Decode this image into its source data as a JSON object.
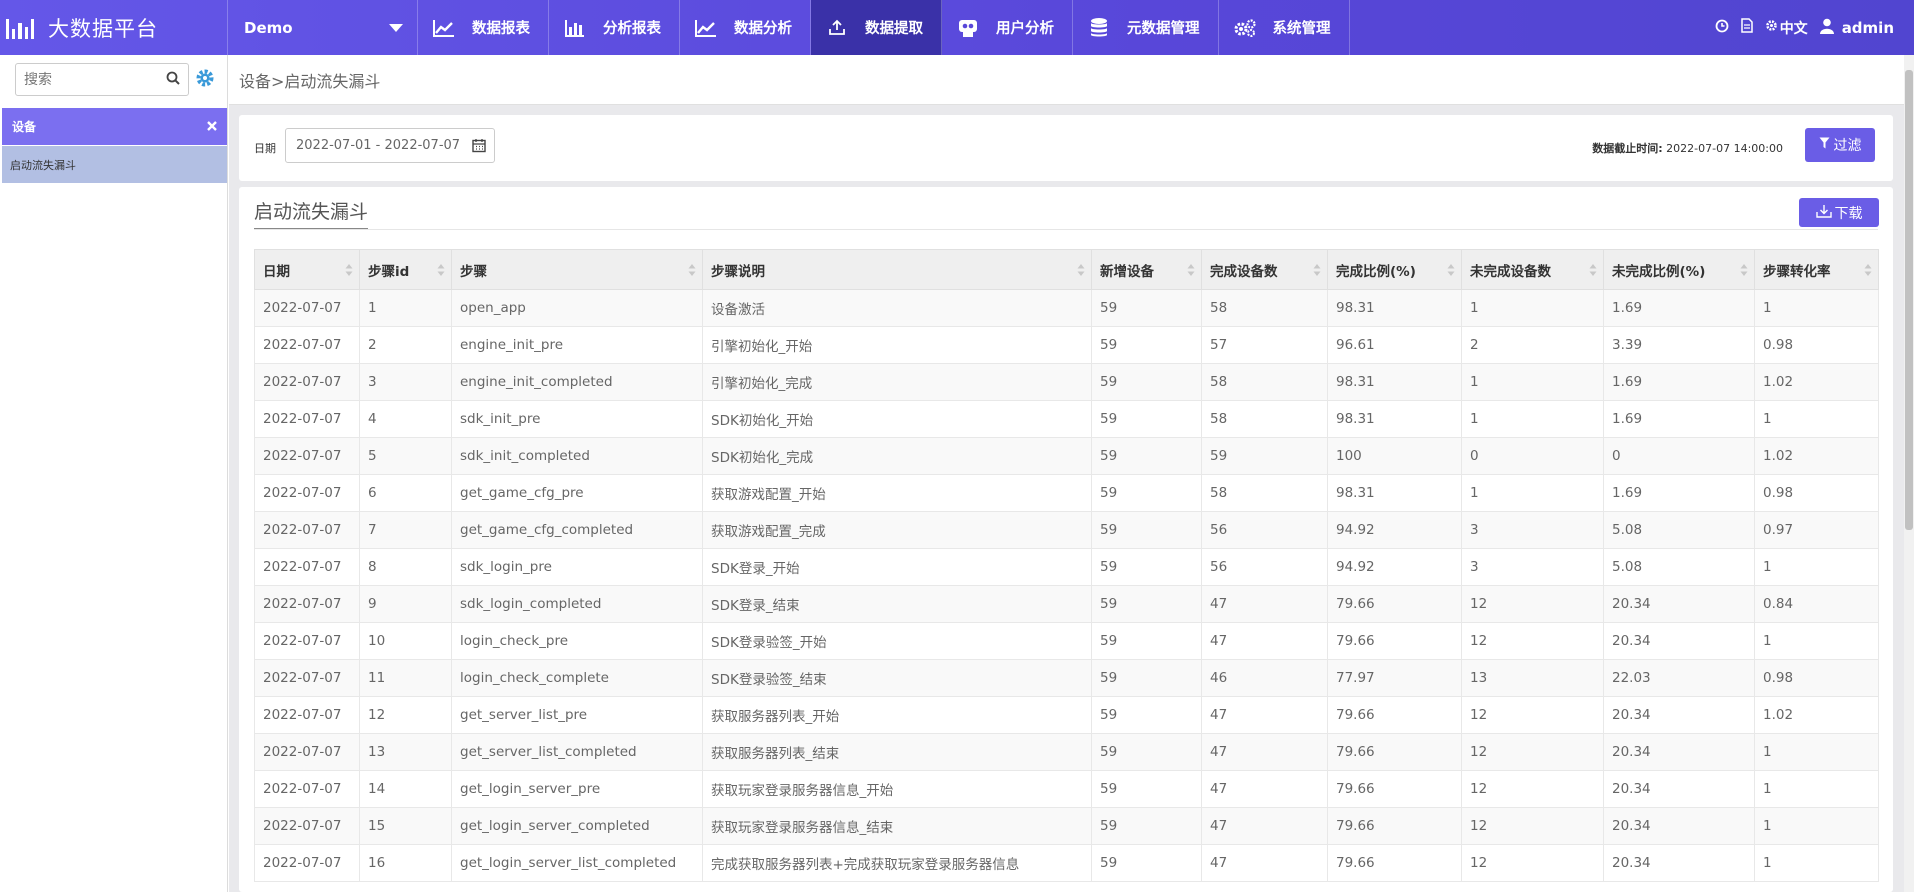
{
  "app": {
    "title": "大数据平台"
  },
  "project": {
    "selected": "Demo"
  },
  "nav": [
    {
      "label": "数据报表",
      "icon": "line-chart-icon"
    },
    {
      "label": "分析报表",
      "icon": "bar-chart-icon"
    },
    {
      "label": "数据分析",
      "icon": "line-chart-icon"
    },
    {
      "label": "数据提取",
      "icon": "upload-icon",
      "active": true
    },
    {
      "label": "用户分析",
      "icon": "users-icon"
    },
    {
      "label": "元数据管理",
      "icon": "database-icon"
    },
    {
      "label": "系统管理",
      "icon": "gears-icon"
    }
  ],
  "topRight": {
    "lang": "中文",
    "user": "admin"
  },
  "sidebar": {
    "searchPlaceholder": "搜索",
    "group": "设备",
    "item": "启动流失漏斗"
  },
  "breadcrumb": "设备>启动流失漏斗",
  "filter": {
    "dateLabel": "日期",
    "dateRange": "2022-07-01 - 2022-07-07",
    "cutoffLabel": "数据截止时间:",
    "cutoffValue": "2022-07-07 14:00:00",
    "filterButton": "过滤"
  },
  "card": {
    "title": "启动流失漏斗",
    "downloadButton": "下载"
  },
  "table": {
    "headers": [
      "日期",
      "步骤id",
      "步骤",
      "步骤说明",
      "新增设备",
      "完成设备数",
      "完成比例(%)",
      "未完成设备数",
      "未完成比例(%)",
      "步骤转化率"
    ],
    "rows": [
      [
        "2022-07-07",
        "1",
        "open_app",
        "设备激活",
        "59",
        "58",
        "98.31",
        "1",
        "1.69",
        "1"
      ],
      [
        "2022-07-07",
        "2",
        "engine_init_pre",
        "引擎初始化_开始",
        "59",
        "57",
        "96.61",
        "2",
        "3.39",
        "0.98"
      ],
      [
        "2022-07-07",
        "3",
        "engine_init_completed",
        "引擎初始化_完成",
        "59",
        "58",
        "98.31",
        "1",
        "1.69",
        "1.02"
      ],
      [
        "2022-07-07",
        "4",
        "sdk_init_pre",
        "SDK初始化_开始",
        "59",
        "58",
        "98.31",
        "1",
        "1.69",
        "1"
      ],
      [
        "2022-07-07",
        "5",
        "sdk_init_completed",
        "SDK初始化_完成",
        "59",
        "59",
        "100",
        "0",
        "0",
        "1.02"
      ],
      [
        "2022-07-07",
        "6",
        "get_game_cfg_pre",
        "获取游戏配置_开始",
        "59",
        "58",
        "98.31",
        "1",
        "1.69",
        "0.98"
      ],
      [
        "2022-07-07",
        "7",
        "get_game_cfg_completed",
        "获取游戏配置_完成",
        "59",
        "56",
        "94.92",
        "3",
        "5.08",
        "0.97"
      ],
      [
        "2022-07-07",
        "8",
        "sdk_login_pre",
        "SDK登录_开始",
        "59",
        "56",
        "94.92",
        "3",
        "5.08",
        "1"
      ],
      [
        "2022-07-07",
        "9",
        "sdk_login_completed",
        "SDK登录_结束",
        "59",
        "47",
        "79.66",
        "12",
        "20.34",
        "0.84"
      ],
      [
        "2022-07-07",
        "10",
        "login_check_pre",
        "SDK登录验签_开始",
        "59",
        "47",
        "79.66",
        "12",
        "20.34",
        "1"
      ],
      [
        "2022-07-07",
        "11",
        "login_check_complete",
        "SDK登录验签_结束",
        "59",
        "46",
        "77.97",
        "13",
        "22.03",
        "0.98"
      ],
      [
        "2022-07-07",
        "12",
        "get_server_list_pre",
        "获取服务器列表_开始",
        "59",
        "47",
        "79.66",
        "12",
        "20.34",
        "1.02"
      ],
      [
        "2022-07-07",
        "13",
        "get_server_list_completed",
        "获取服务器列表_结束",
        "59",
        "47",
        "79.66",
        "12",
        "20.34",
        "1"
      ],
      [
        "2022-07-07",
        "14",
        "get_login_server_pre",
        "获取玩家登录服务器信息_开始",
        "59",
        "47",
        "79.66",
        "12",
        "20.34",
        "1"
      ],
      [
        "2022-07-07",
        "15",
        "get_login_server_completed",
        "获取玩家登录服务器信息_结束",
        "59",
        "47",
        "79.66",
        "12",
        "20.34",
        "1"
      ],
      [
        "2022-07-07",
        "16",
        "get_login_server_list_completed",
        "完成获取服务器列表+完成获取玩家登录服务器信息",
        "59",
        "47",
        "79.66",
        "12",
        "20.34",
        "1"
      ]
    ]
  }
}
